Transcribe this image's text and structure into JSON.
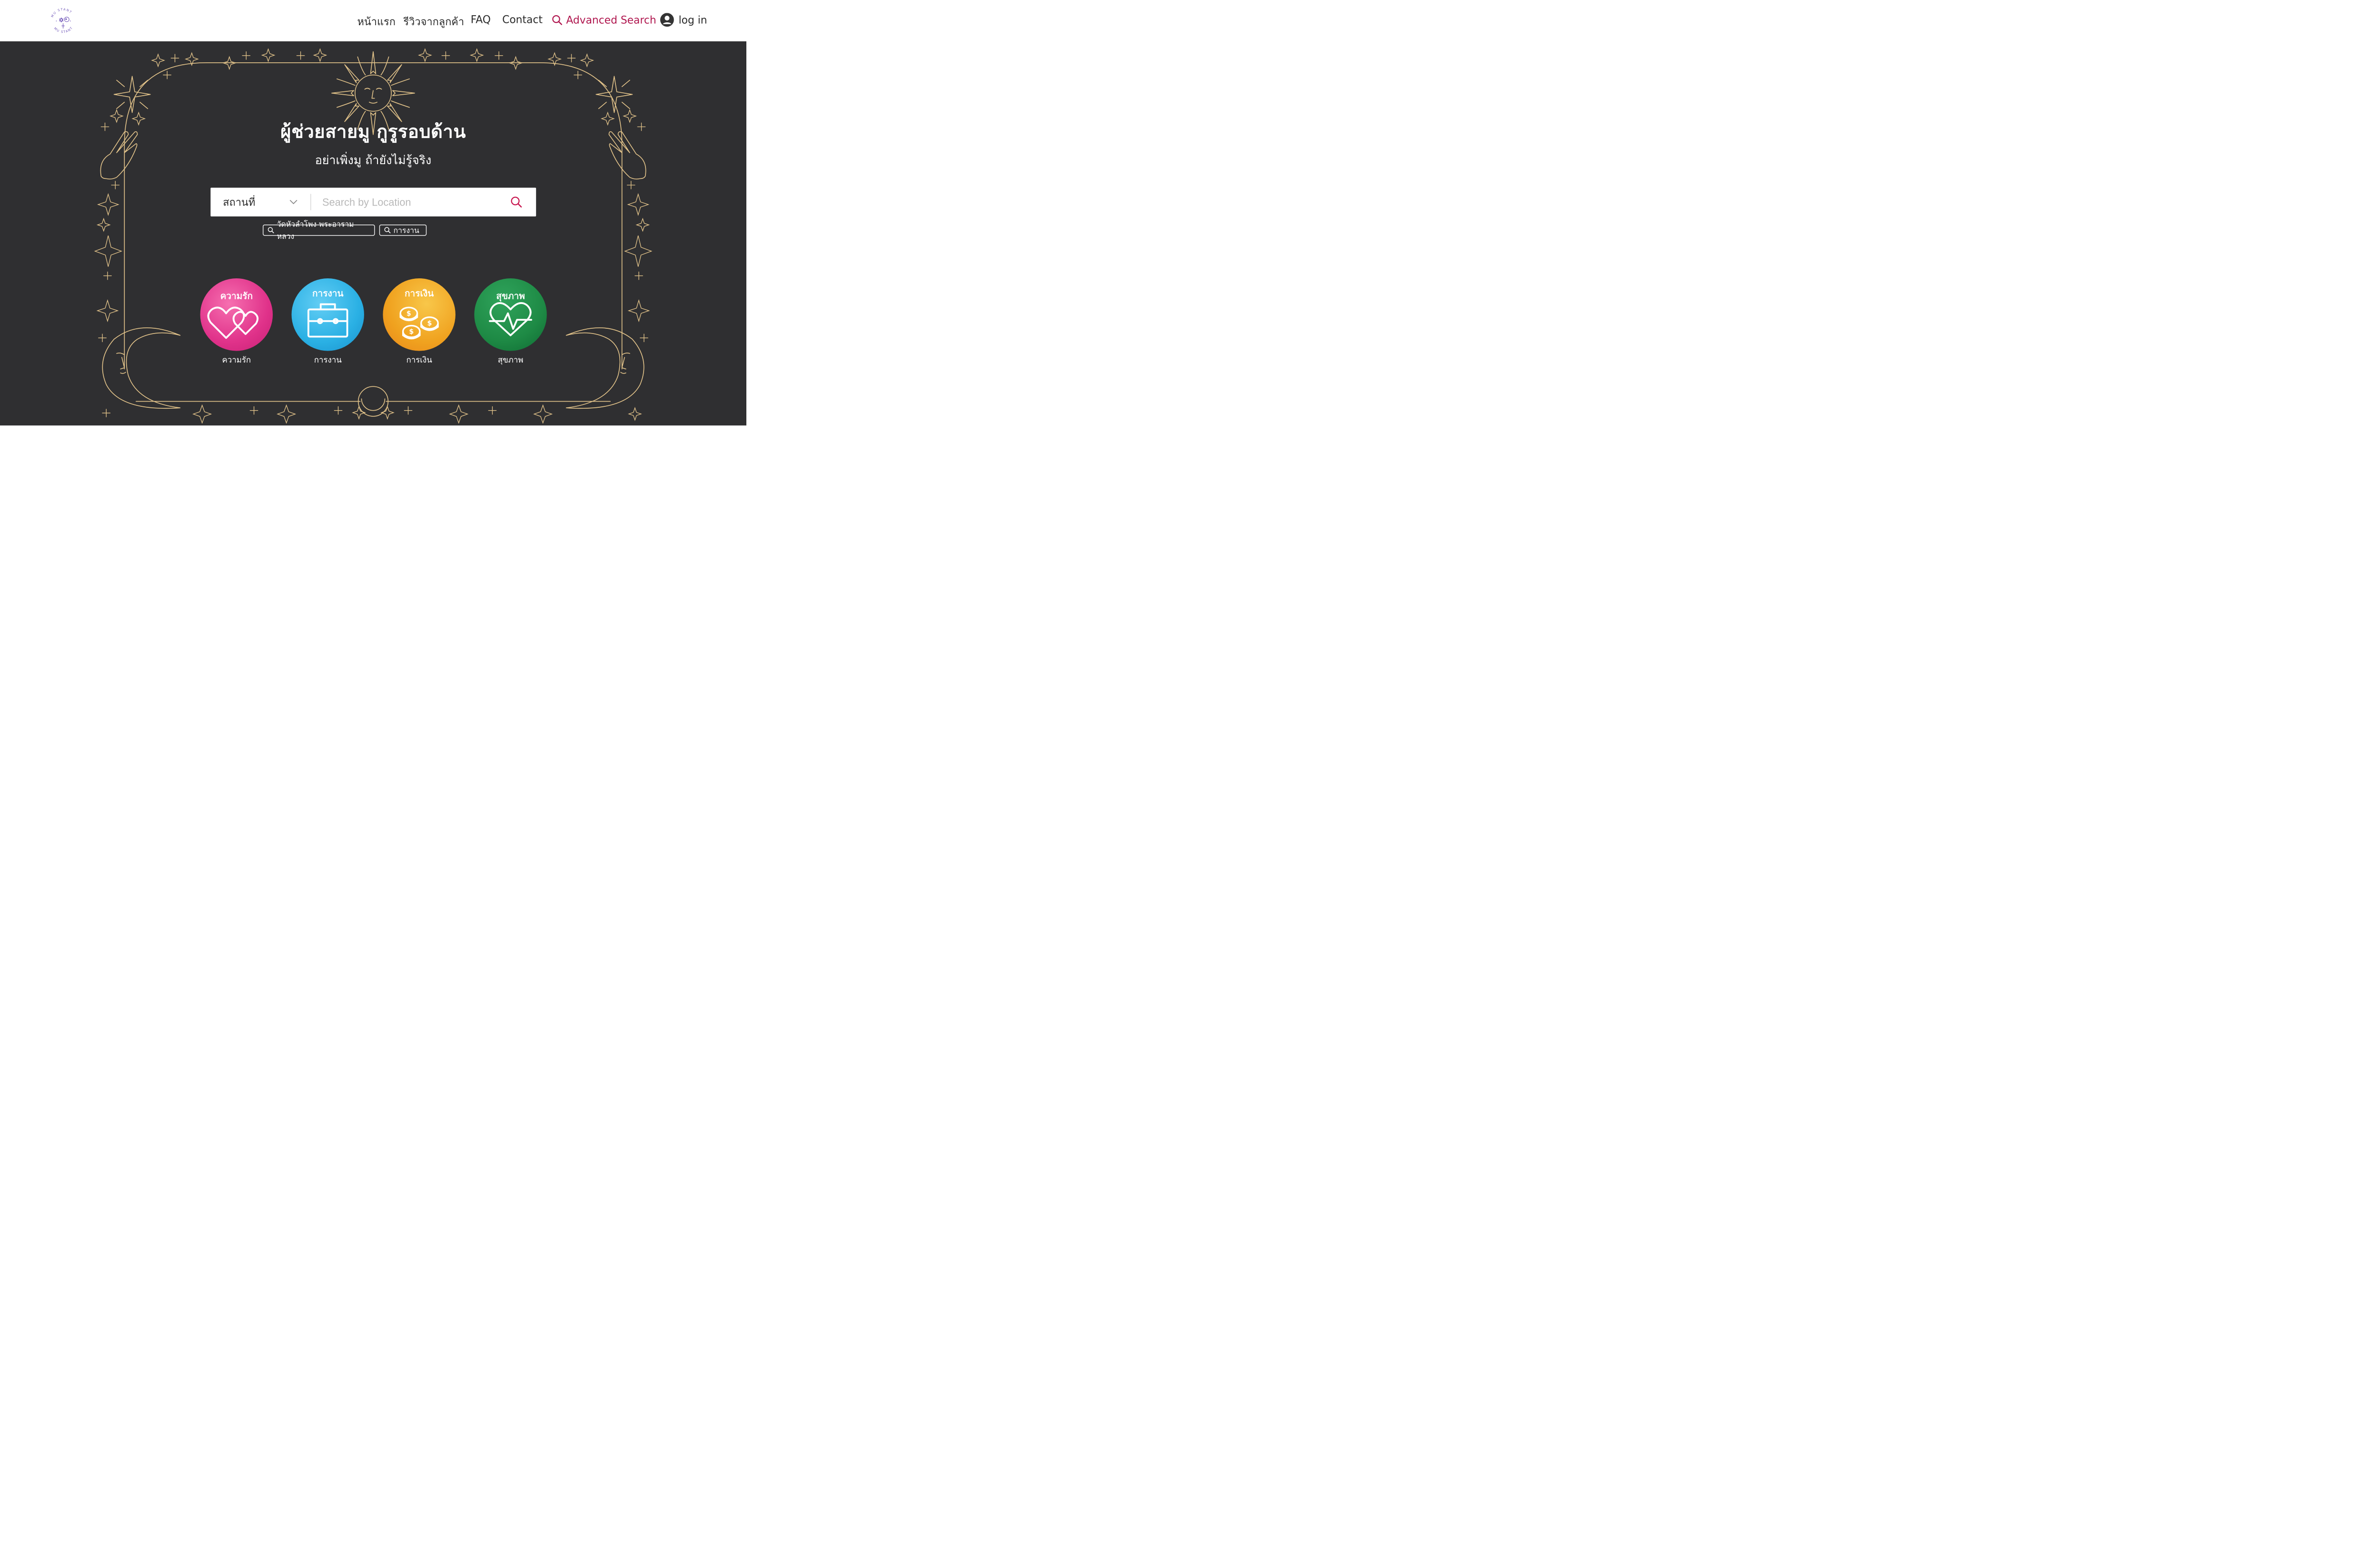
{
  "header": {
    "logo_text": "MU STANT",
    "nav": {
      "home": "หน้าแรก",
      "reviews": "รีวิวจากลูกค้า",
      "faq": "FAQ",
      "contact": "Contact",
      "advanced_search": "Advanced Search",
      "login": "log in"
    }
  },
  "hero": {
    "title": "ผู้ช่วยสายมู  กูรูรอบด้าน",
    "subtitle": "อย่าเพิ่งมู ถ้ายังไม่รู้จริง"
  },
  "search": {
    "category_value": "สถานที่",
    "placeholder": "Search by Location",
    "suggestions": [
      "วัดหัวลำโพง พระอารามหลวง",
      "การงาน"
    ]
  },
  "categories": [
    {
      "label": "ความรัก",
      "caption": "ความรัก",
      "icon": "hearts-icon",
      "color": "#e43d8e"
    },
    {
      "label": "การงาน",
      "caption": "การงาน",
      "icon": "briefcase-icon",
      "color": "#2fb0e6"
    },
    {
      "label": "การเงิน",
      "caption": "การเงิน",
      "icon": "coins-icon",
      "color": "#f0a21f"
    },
    {
      "label": "สุขภาพ",
      "caption": "สุขภาพ",
      "icon": "heart-pulse-icon",
      "color": "#1e8a45"
    }
  ],
  "colors": {
    "accent": "#b0174f",
    "hero_bg": "#2f2f31",
    "gold_line": "#e2c38a",
    "logo": "#6f55b8"
  }
}
